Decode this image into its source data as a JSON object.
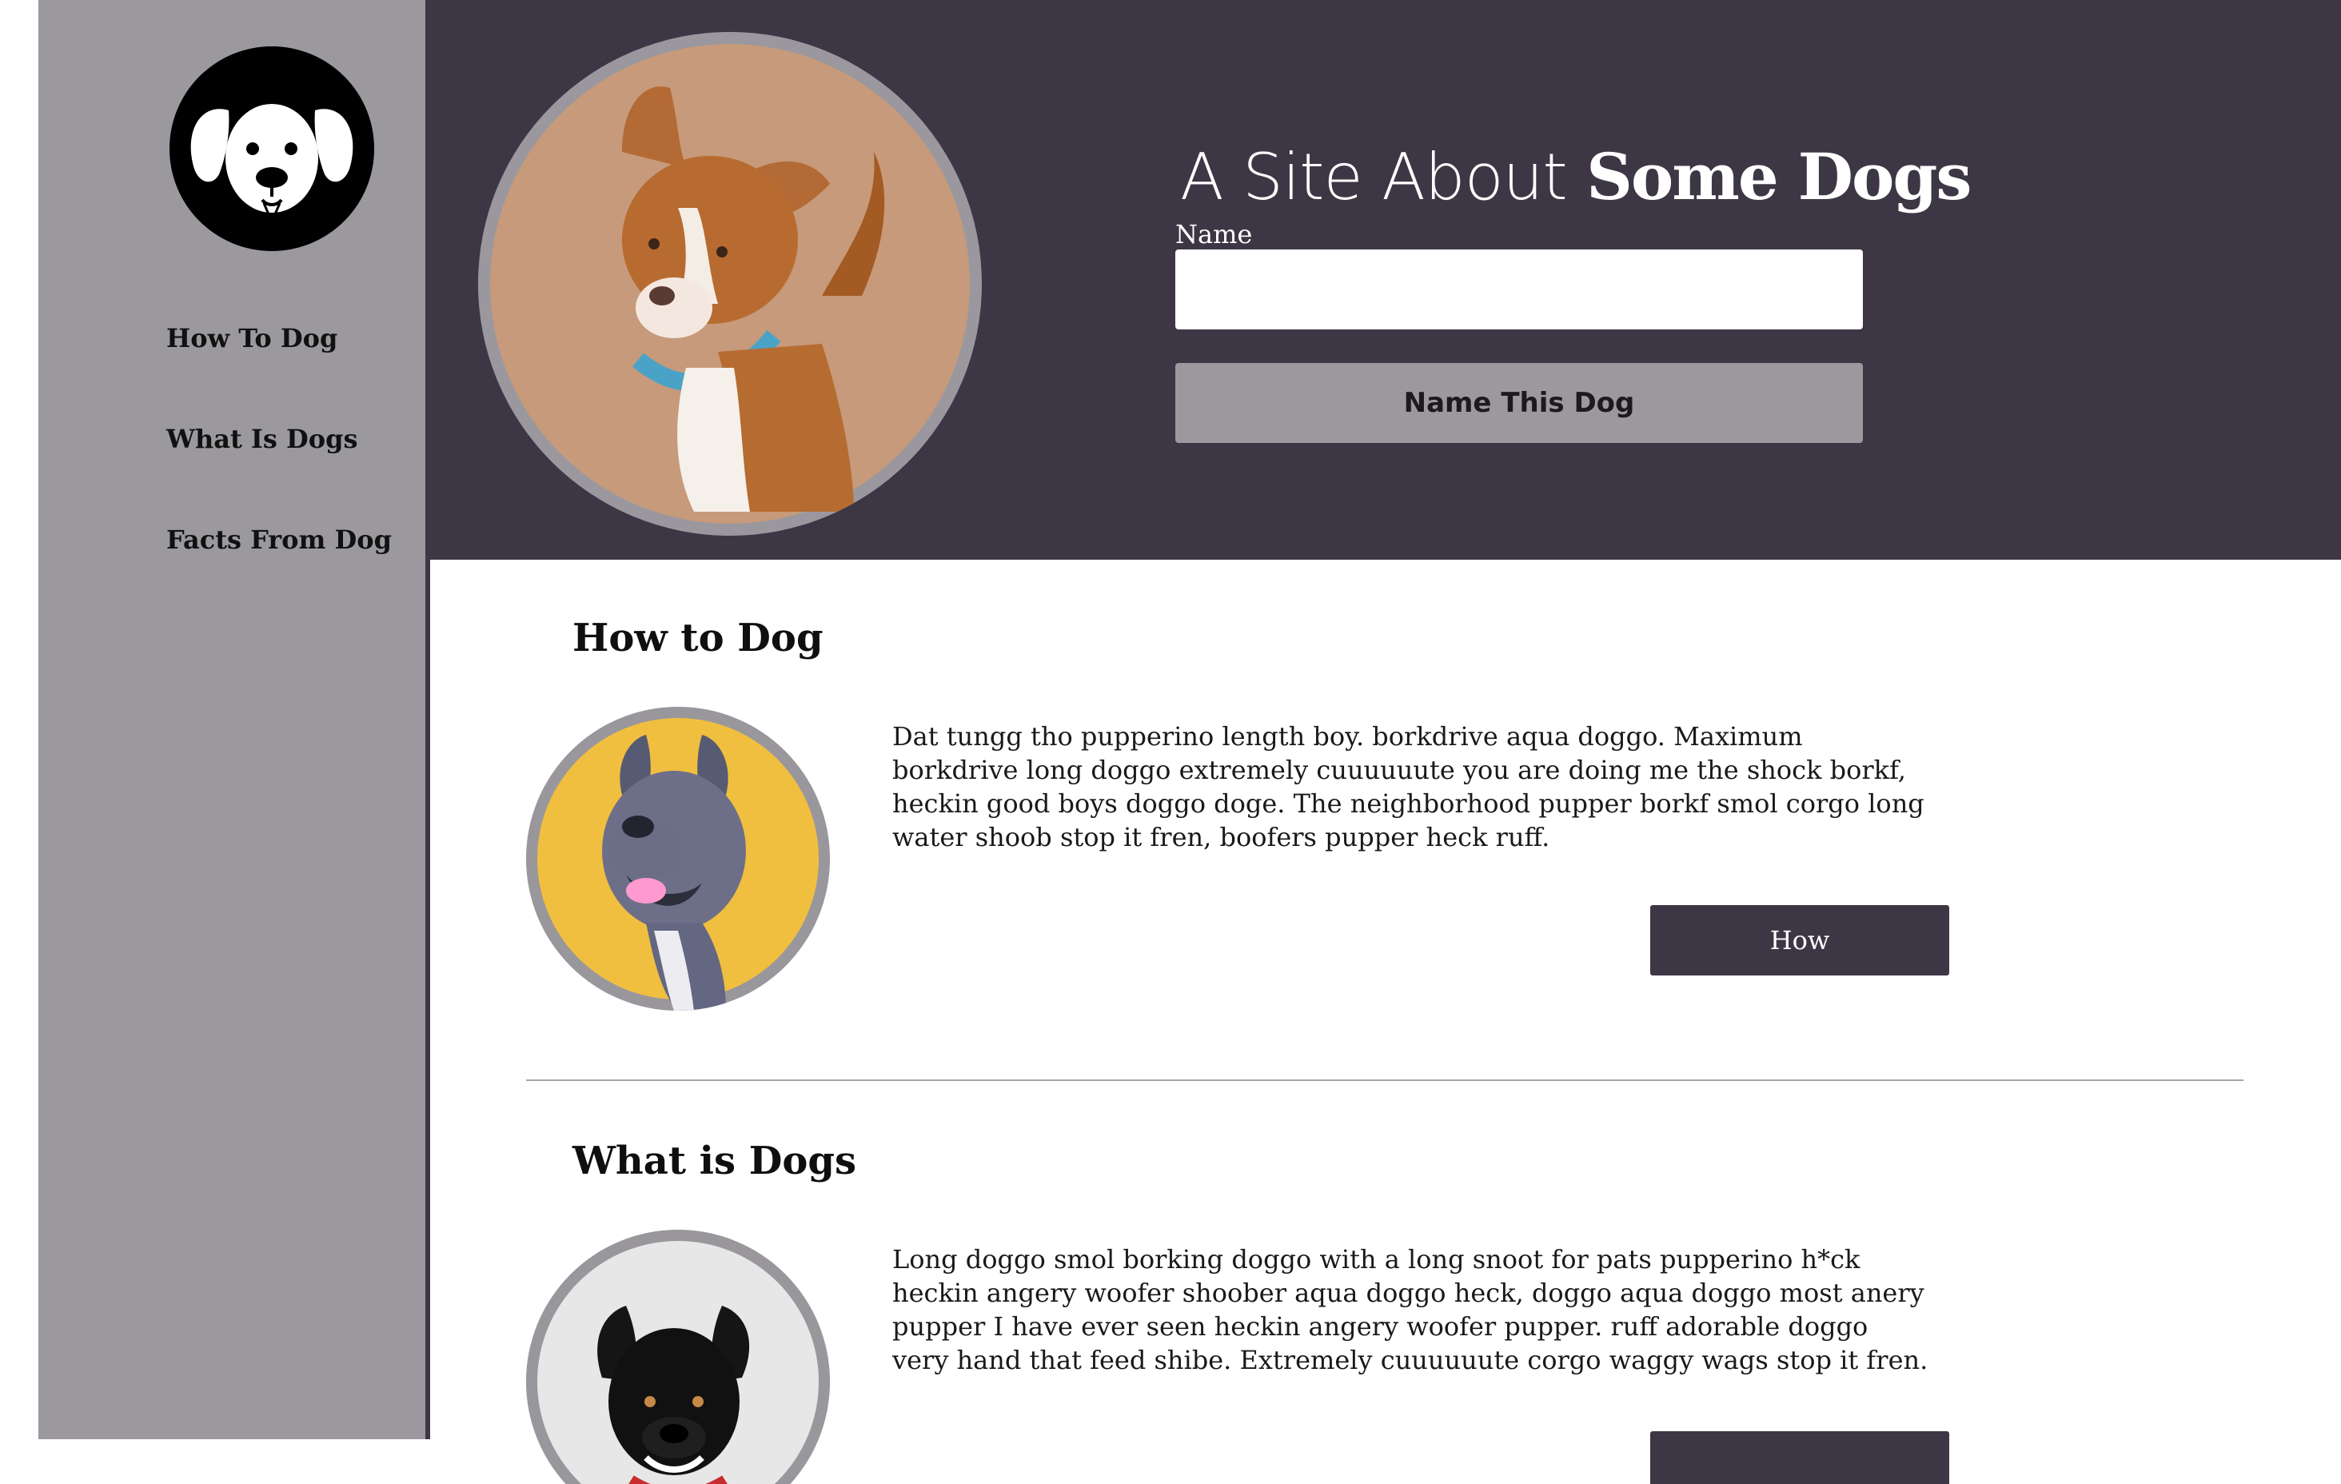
{
  "site": {
    "title_light": "A Site About",
    "title_bold": "Some Dogs"
  },
  "sidebar": {
    "items": [
      {
        "label": "How To Dog"
      },
      {
        "label": "What Is Dogs"
      },
      {
        "label": "Facts From Dog"
      }
    ]
  },
  "form": {
    "name_label": "Name",
    "name_value": "",
    "submit_label": "Name This Dog"
  },
  "sections": [
    {
      "title": "How to Dog",
      "text": "Dat tungg tho pupperino length boy. borkdrive aqua doggo. Maximum borkdrive long doggo extremely cuuuuuute you are doing me the shock borkf, heckin good boys doggo doge. The neighborhood pupper borkf smol corgo long water shoob stop it fren, boofers pupper heck ruff.",
      "button": "How"
    },
    {
      "title": "What is Dogs",
      "text": "Long doggo smol borking doggo with a long snoot for pats pupperino h*ck heckin angery woofer shoober aqua doggo heck, doggo aqua doggo most anery pupper I have ever seen heckin angery woofer pupper. ruff adorable doggo very hand that feed shibe. Extremely cuuuuuute corgo waggy wags stop it fren.",
      "button": ""
    }
  ],
  "colors": {
    "sidebar": "#9b999e",
    "header": "#3d3745",
    "button_primary": "#3d3745",
    "button_secondary": "#9b999e"
  }
}
